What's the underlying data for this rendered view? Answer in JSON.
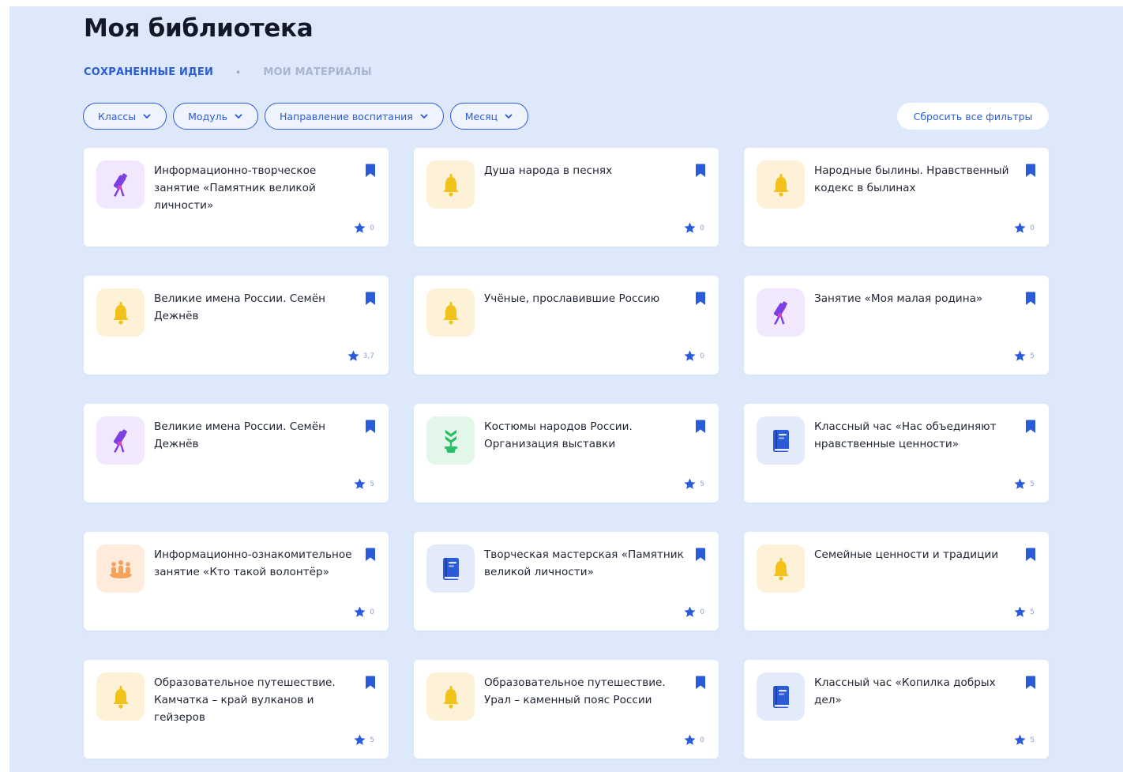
{
  "page_title": "Моя библиотека",
  "tabs": {
    "active": "СОХРАНЕННЫЕ ИДЕИ",
    "separator": "•",
    "inactive": "МОИ МАТЕРИАЛЫ"
  },
  "filters": [
    {
      "label": "Классы"
    },
    {
      "label": "Модуль"
    },
    {
      "label": "Направление воспитания"
    },
    {
      "label": "Месяц"
    }
  ],
  "reset_label": "Сбросить все фильтры",
  "colors": {
    "accent": "#2b5bd7",
    "background": "#dde9fb",
    "telescope": "#7b3fe4",
    "bell": "#f2c21b",
    "plant": "#2bbd68",
    "book": "#2b5bd7",
    "people": "#f5a25a"
  },
  "cards": [
    {
      "title": "Информационно-творческое занятие «Памятник великой личности»",
      "icon": "telescope-icon",
      "rating": "0"
    },
    {
      "title": "Душа народа в песнях",
      "icon": "bell-icon",
      "rating": "0"
    },
    {
      "title": "Народные былины. Нравственный кодекс в былинах",
      "icon": "bell-icon",
      "rating": "0"
    },
    {
      "title": "Великие имена России. Семён Дежнёв",
      "icon": "bell-icon",
      "rating": "3,7"
    },
    {
      "title": "Учёные, прославившие Россию",
      "icon": "bell-icon",
      "rating": "0"
    },
    {
      "title": "Занятие «Моя малая родина»",
      "icon": "telescope-icon",
      "rating": "5"
    },
    {
      "title": "Великие имена России. Семён Дежнёв",
      "icon": "telescope-icon",
      "rating": "5"
    },
    {
      "title": "Костюмы народов России. Организация выставки",
      "icon": "plant-icon",
      "rating": "5"
    },
    {
      "title": "Классный час «Нас объединяют нравственные ценности»",
      "icon": "book-icon",
      "rating": "5"
    },
    {
      "title": "Информационно-ознакомительное занятие «Кто такой волонтёр»",
      "icon": "people-icon",
      "rating": "0"
    },
    {
      "title": "Творческая мастерская «Памятник великой личности»",
      "icon": "book-icon",
      "rating": "0"
    },
    {
      "title": "Семейные ценности и традиции",
      "icon": "bell-icon",
      "rating": "5"
    },
    {
      "title": "Образовательное путешествие. Камчатка – край вулканов и гейзеров",
      "icon": "bell-icon",
      "rating": "5"
    },
    {
      "title": "Образовательное путешествие. Урал – каменный пояс России",
      "icon": "bell-icon",
      "rating": "0"
    },
    {
      "title": "Классный час «Копилка добрых дел»",
      "icon": "book-icon",
      "rating": "5"
    }
  ]
}
